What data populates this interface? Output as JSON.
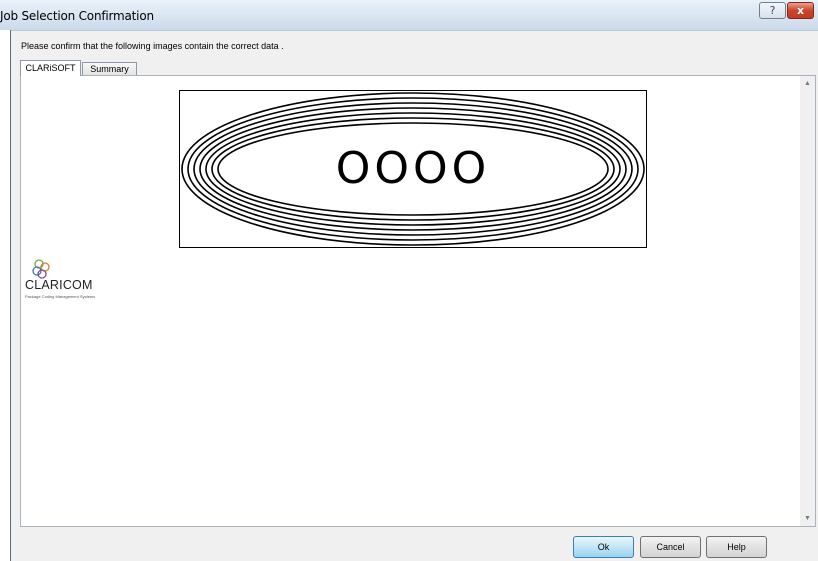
{
  "window": {
    "title": "Job Selection Confirmation",
    "help_glyph": "?",
    "close_glyph": "x"
  },
  "prompt": "Please confirm that the following images contain the correct data .",
  "tabs": [
    {
      "label": "CLARiSOFT",
      "active": true
    },
    {
      "label": "Summary",
      "active": false
    }
  ],
  "preview": {
    "label_text": "OOOO"
  },
  "logo": {
    "name": "CLARICOM",
    "tagline": "Package Coding Management Systems"
  },
  "buttons": {
    "ok": "Ok",
    "cancel": "Cancel",
    "help": "Help"
  },
  "colors": {
    "ok_accent": "#98d1ef",
    "close_red": "#c8452a",
    "logo_circles": [
      "#6fa84a",
      "#e07b2a",
      "#3a76b8",
      "#7a4a9a"
    ]
  }
}
